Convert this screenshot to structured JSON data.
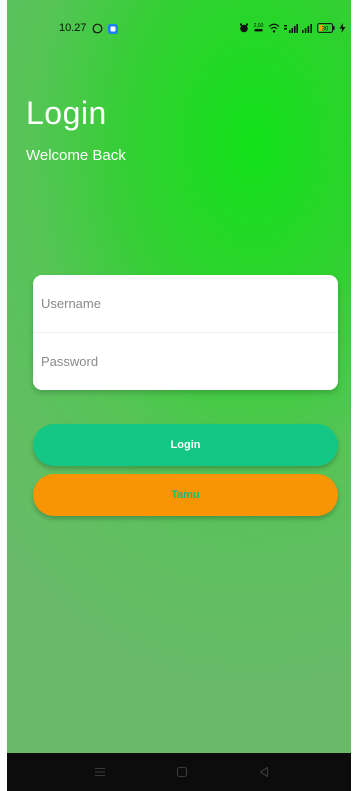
{
  "status_bar": {
    "time": "10.27",
    "left_icons": [
      "whatsapp-icon",
      "notification-app-icon"
    ],
    "right_icons": [
      "alarm-icon",
      "data-speed-icon",
      "wifi-icon",
      "signal-icon",
      "signal-icon",
      "battery-icon",
      "charging-icon"
    ],
    "data_speed": "2,00",
    "battery_level": "30"
  },
  "header": {
    "title": "Login",
    "subtitle": "Welcome Back"
  },
  "form": {
    "username_placeholder": "Username",
    "password_placeholder": "Password"
  },
  "buttons": {
    "login_label": "Login",
    "guest_label": "Tamu"
  },
  "nav_bar": {
    "icons": [
      "menu-icon",
      "home-icon",
      "back-icon"
    ]
  },
  "colors": {
    "background_primary": "#12e21a",
    "background_secondary": "#6aba6a",
    "login_button": "#15c784",
    "guest_button": "#f99405",
    "guest_label": "#22b773",
    "nav_bar": "#0c0c0c"
  }
}
